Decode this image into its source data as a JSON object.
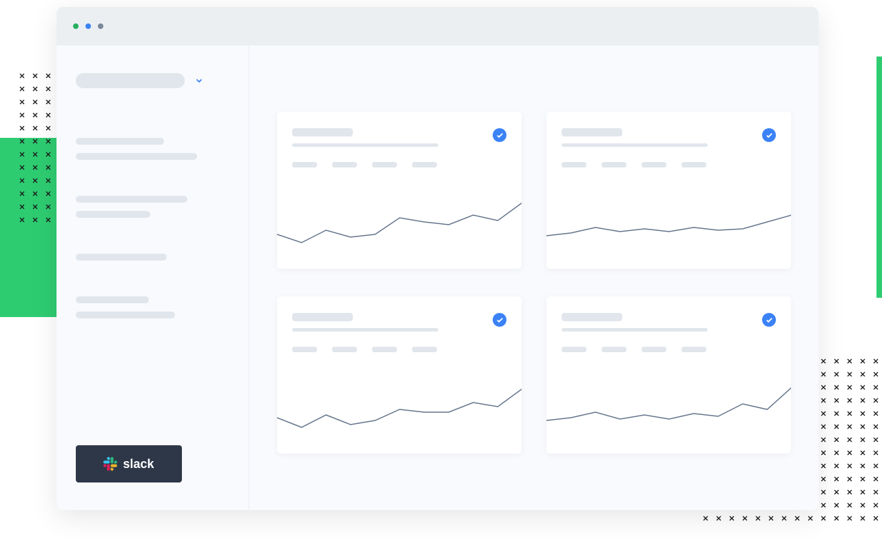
{
  "window": {
    "dots": [
      "green",
      "blue",
      "grey"
    ]
  },
  "sidebar": {
    "dropdown_label": "",
    "groups": [
      {
        "items": [
          "",
          ""
        ]
      },
      {
        "items": [
          "",
          ""
        ]
      },
      {
        "items": [
          ""
        ]
      },
      {
        "items": [
          "",
          ""
        ]
      }
    ],
    "slack_label": "slack"
  },
  "cards": [
    {
      "title": "",
      "subtitle": "",
      "checked": true,
      "stats": [
        "",
        "",
        "",
        ""
      ]
    },
    {
      "title": "",
      "subtitle": "",
      "checked": true,
      "stats": [
        "",
        "",
        "",
        ""
      ]
    },
    {
      "title": "",
      "subtitle": "",
      "checked": true,
      "stats": [
        "",
        "",
        "",
        ""
      ]
    },
    {
      "title": "",
      "subtitle": "",
      "checked": true,
      "stats": [
        "",
        "",
        "",
        ""
      ]
    }
  ],
  "chart_data": [
    {
      "type": "line",
      "x": [
        0,
        1,
        2,
        3,
        4,
        5,
        6,
        7,
        8,
        9,
        10
      ],
      "values": [
        50,
        38,
        56,
        46,
        50,
        74,
        68,
        64,
        78,
        70,
        96
      ],
      "ylim": [
        0,
        130
      ]
    },
    {
      "type": "line",
      "x": [
        0,
        1,
        2,
        3,
        4,
        5,
        6,
        7,
        8,
        9,
        10
      ],
      "values": [
        48,
        52,
        60,
        54,
        58,
        54,
        60,
        56,
        58,
        68,
        78
      ],
      "ylim": [
        0,
        130
      ]
    },
    {
      "type": "line",
      "x": [
        0,
        1,
        2,
        3,
        4,
        5,
        6,
        7,
        8,
        9,
        10
      ],
      "values": [
        52,
        38,
        56,
        42,
        48,
        64,
        60,
        60,
        74,
        68,
        94
      ],
      "ylim": [
        0,
        130
      ]
    },
    {
      "type": "line",
      "x": [
        0,
        1,
        2,
        3,
        4,
        5,
        6,
        7,
        8,
        9,
        10
      ],
      "values": [
        48,
        52,
        60,
        50,
        56,
        50,
        58,
        54,
        72,
        64,
        96
      ],
      "ylim": [
        0,
        130
      ]
    }
  ],
  "colors": {
    "accent": "#3b82f6",
    "chartline": "#64748b",
    "green": "#2ecc71"
  }
}
